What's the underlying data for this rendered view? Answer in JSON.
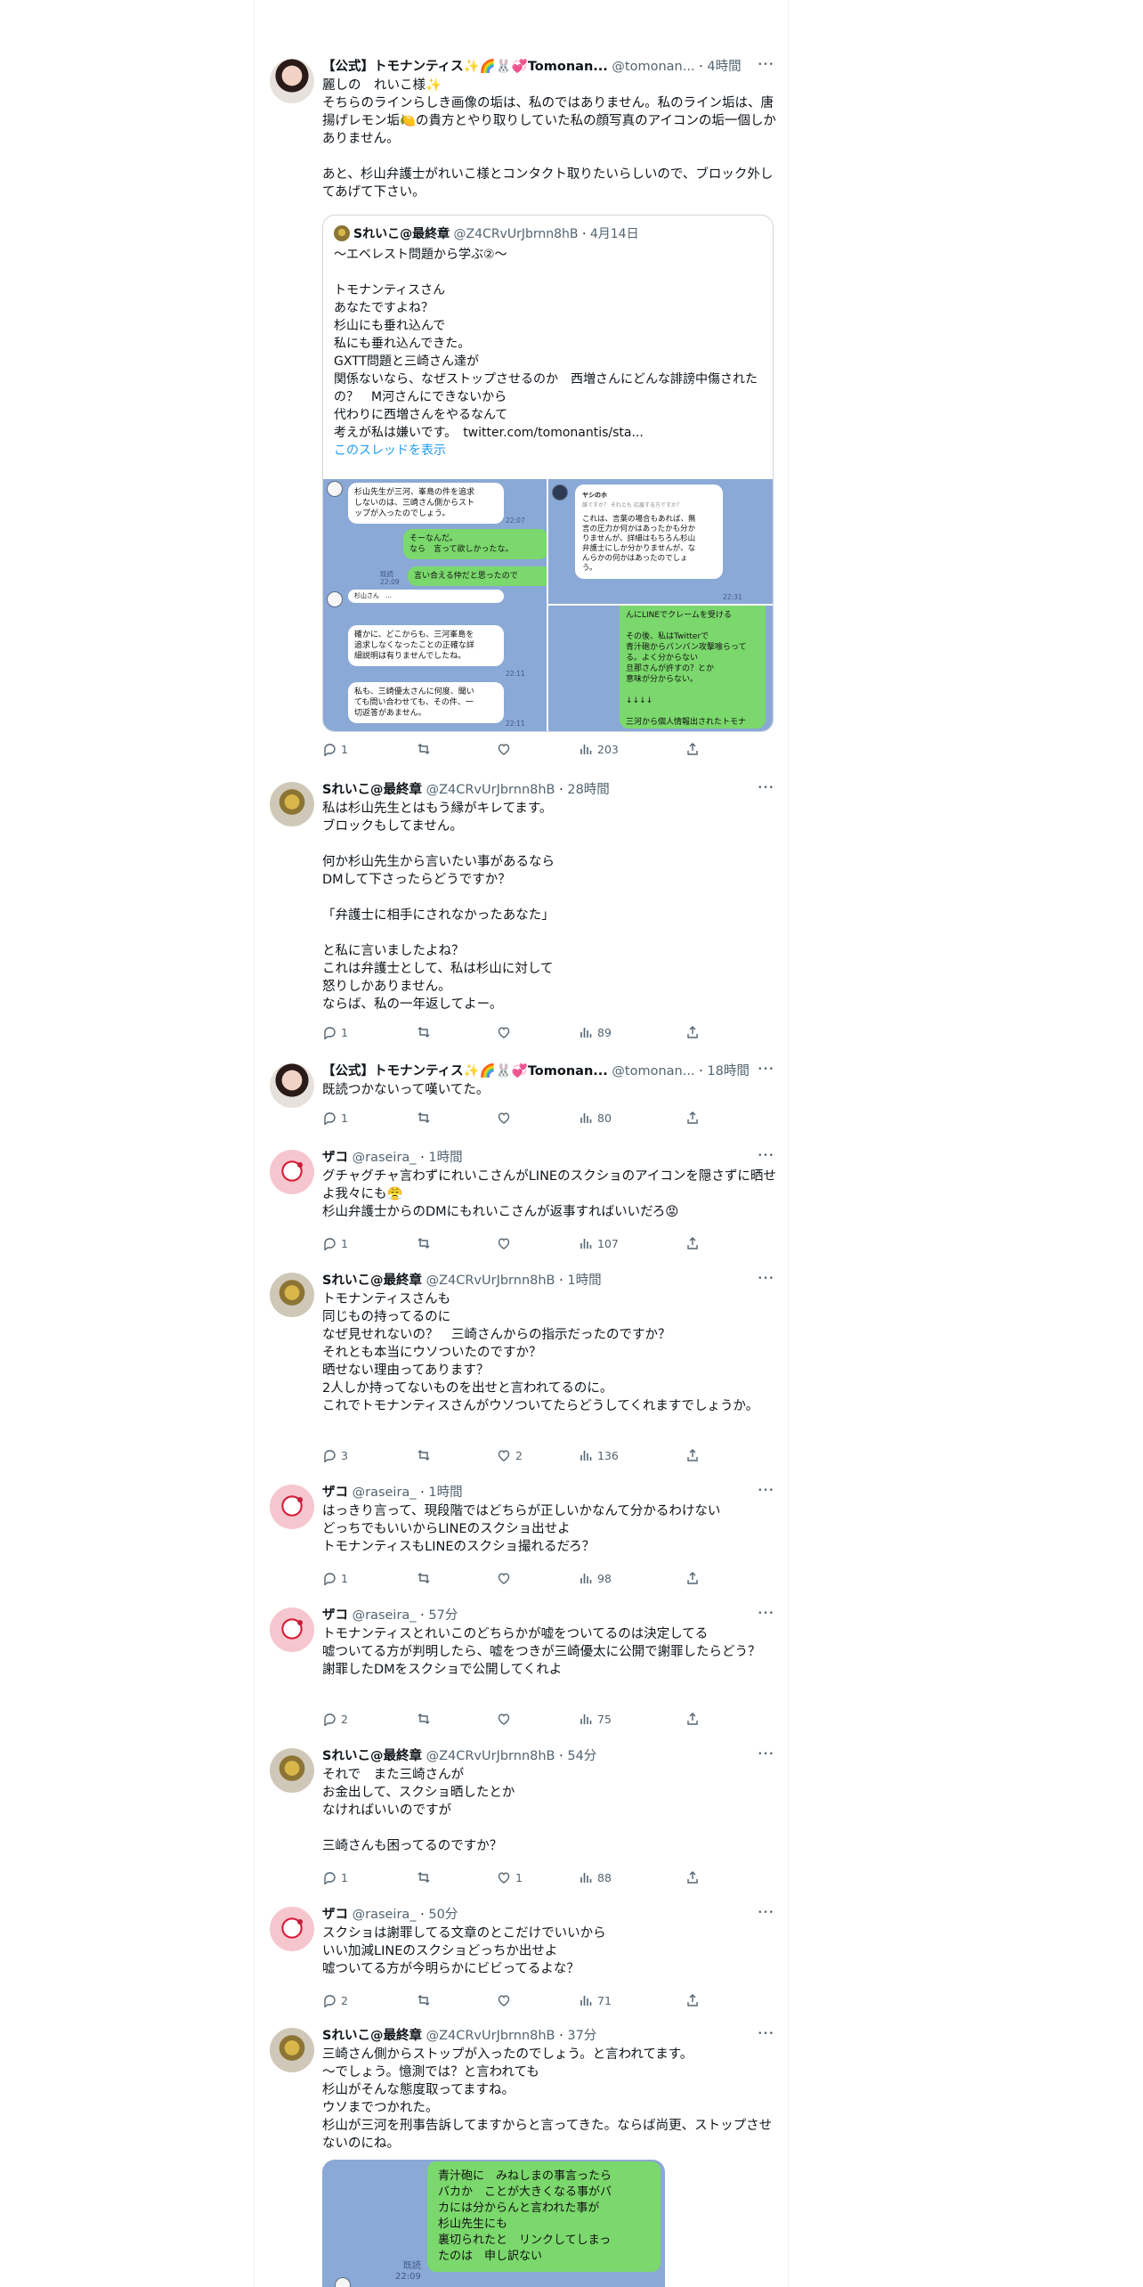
{
  "tweets": [
    {
      "avatar": "tomonantis-avatar",
      "name": "【公式】トモナンティス✨🌈🐰💞Tomonan...",
      "handle": "@tomonan...",
      "time": "4時間",
      "text": "麗しの　れいこ様✨\nそちらのラインらしき画像の垢は、私のではありません。私のライン垢は、唐揚げレモン垢🍋の貴方とやり取りしていた私の顔写真のアイコンの垢一個しかありません。\n\nあと、杉山弁護士がれいこ様とコンタクト取りたいらしいので、ブロック外してあげて下さい。",
      "quote": {
        "name": "Sれいこ@最終章",
        "handle": "@Z4CRvUrJbrnn8hB",
        "time": "4月14日",
        "text": "〜エベレスト問題から学ぶ②〜\n\nトモナンティスさん\nあなたですよね？\n杉山にも垂れ込んで\n私にも垂れ込んできた。\nGXTT問題と三崎さん達が\n関係ないなら、なぜストップさせるのか　西増さんにどんな誹謗中傷されたの？　M河さんにできないから\n代わりに西増さんをやるなんて\n考えが私は嫌いです。　",
        "link": "twitter.com/tomonantis/sta...",
        "show_thread": "このスレッドを表示",
        "images": {
          "left": {
            "bubbles": [
              "杉山先生が三河、峯島の件を追求\nしないのは、三崎さん側からスト\nップが入ったのでしょう。",
              "そーなんだ。\nなら　言って欲しかったな。",
              "言い合える仲だと思ったので",
              "杉山さん　...",
              "確かに、どこからも、三河峯島を\n追求しなくなったことの正確な詳\n細説明は有りませんでしたね。",
              "私も、三崎優太さんに何度、聞い\nても問い合わせても、その件、一\n切返答があません。"
            ],
            "times": [
              "22:07",
              "既読\n22:09",
              "22:11",
              "22:11"
            ]
          },
          "topright": {
            "sender": "ヤシのホ",
            "sub": "誰ですか？ それとも 応援する方ですか？",
            "bubble": "これは、言葉の場合もあれば、無\n言の圧力か何かはあったかも分か\nりませんが、詳細はもちろん杉山\n弁護士にしか分かりませんが、な\nんらかの何かはあったのでしょ\nう。",
            "time": "22:31"
          },
          "bottomright": {
            "bubble": "んにLINEでクレームを受ける\n\nその後、私はTwitterで\n青汁砲からバンバン攻撃喰らって\nる。よく分からない\n旦那さんが許すの？とか\n意味が分からない。\n\n↓↓↓↓\n\n三河から個人情報出されたトモナ"
          }
        }
      },
      "stats": {
        "reply": "1",
        "retweet": "",
        "like": "",
        "views": "203"
      }
    },
    {
      "avatar": "reiko-avatar",
      "name": "Sれいこ@最終章",
      "handle": "@Z4CRvUrJbrnn8hB",
      "time": "28時間",
      "text": "私は杉山先生とはもう縁がキレてます。\nブロックもしてません。\n\n何か杉山先生から言いたい事があるなら\nDMして下さったらどうですか？\n\n「弁護士に相手にされなかったあなた」\n\nと私に言いましたよね？\nこれは弁護士として、私は杉山に対して\n怒りしかありません。\nならば、私の一年返してよー。",
      "stats": {
        "reply": "1",
        "retweet": "",
        "like": "",
        "views": "89"
      }
    },
    {
      "avatar": "tomonantis-avatar",
      "name": "【公式】トモナンティス✨🌈🐰💞Tomonan...",
      "handle": "@tomonan...",
      "time": "18時間",
      "text": "既読つかないって嘆いてた。",
      "stats": {
        "reply": "1",
        "retweet": "",
        "like": "",
        "views": "80"
      }
    },
    {
      "avatar": "zako-avatar",
      "name": "ザコ",
      "handle": "@raseira_",
      "time": "1時間",
      "text": "グチャグチャ言わずにれいこさんがLINEのスクショのアイコンを隠さずに晒せよ我々にも😤\n杉山弁護士からのDMにもれいこさんが返事すればいいだろ😡",
      "stats": {
        "reply": "1",
        "retweet": "",
        "like": "",
        "views": "107"
      }
    },
    {
      "avatar": "reiko-avatar",
      "name": "Sれいこ@最終章",
      "handle": "@Z4CRvUrJbrnn8hB",
      "time": "1時間",
      "text": "トモナンティスさんも\n同じもの持ってるのに\nなぜ見せれないの？　三崎さんからの指示だったのですか？\nそれとも本当にウソついたのですか？\n晒せない理由ってあります？\n2人しか持ってないものを出せと言われてるのに。\nこれでトモナンティスさんがウソついてたらどうしてくれますでしょうか。",
      "stats": {
        "reply": "3",
        "retweet": "",
        "like": "2",
        "views": "136"
      }
    },
    {
      "avatar": "zako-avatar",
      "name": "ザコ",
      "handle": "@raseira_",
      "time": "1時間",
      "text": "はっきり言って、現段階ではどちらが正しいかなんて分かるわけない\nどっちでもいいからLINEのスクショ出せよ\nトモナンティスもLINEのスクショ撮れるだろ？",
      "stats": {
        "reply": "1",
        "retweet": "",
        "like": "",
        "views": "98"
      }
    },
    {
      "avatar": "zako-avatar",
      "name": "ザコ",
      "handle": "@raseira_",
      "time": "57分",
      "text": "トモナンティスとれいこのどちらかが嘘をついてるのは決定してる\n嘘ついてる方が判明したら、嘘をつきが三崎優太に公開で謝罪したらどう？\n謝罪したDMをスクショで公開してくれよ",
      "stats": {
        "reply": "2",
        "retweet": "",
        "like": "",
        "views": "75"
      }
    },
    {
      "avatar": "reiko-avatar",
      "name": "Sれいこ@最終章",
      "handle": "@Z4CRvUrJbrnn8hB",
      "time": "54分",
      "text": "それで　また三崎さんが\nお金出して、スクショ晒したとか\nなければいいのですが\n\n三崎さんも困ってるのですか？",
      "stats": {
        "reply": "1",
        "retweet": "",
        "like": "1",
        "views": "88"
      }
    },
    {
      "avatar": "zako-avatar",
      "name": "ザコ",
      "handle": "@raseira_",
      "time": "50分",
      "text": "スクショは謝罪してる文章のとこだけでいいから\nいい加減LINEのスクショどっちか出せよ\n嘘ついてる方が今明らかにビビってるよな？",
      "stats": {
        "reply": "2",
        "retweet": "",
        "like": "",
        "views": "71"
      }
    },
    {
      "avatar": "reiko-avatar",
      "name": "Sれいこ@最終章",
      "handle": "@Z4CRvUrJbrnn8hB",
      "time": "37分",
      "text": "三崎さん側からストップが入ったのでしょう。と言われてます。\n〜でしょう。憶測では？と言われても\n杉山がそんな態度取ってますね。\nウソまでつかれた。\n杉山が三河を刑事告訴してますからと言ってきた。ならば尚更、ストップさせないのにね。",
      "media": {
        "bubble": "青汁砲に　みねしまの事言ったら\nバカか　ことが大きくなる事がバ\nカには分からんと言われた事が\n杉山先生にも\n裏切られたと　リンクしてしまっ\nたのは　申し訳ない",
        "time": "既読\n22:09"
      }
    }
  ]
}
